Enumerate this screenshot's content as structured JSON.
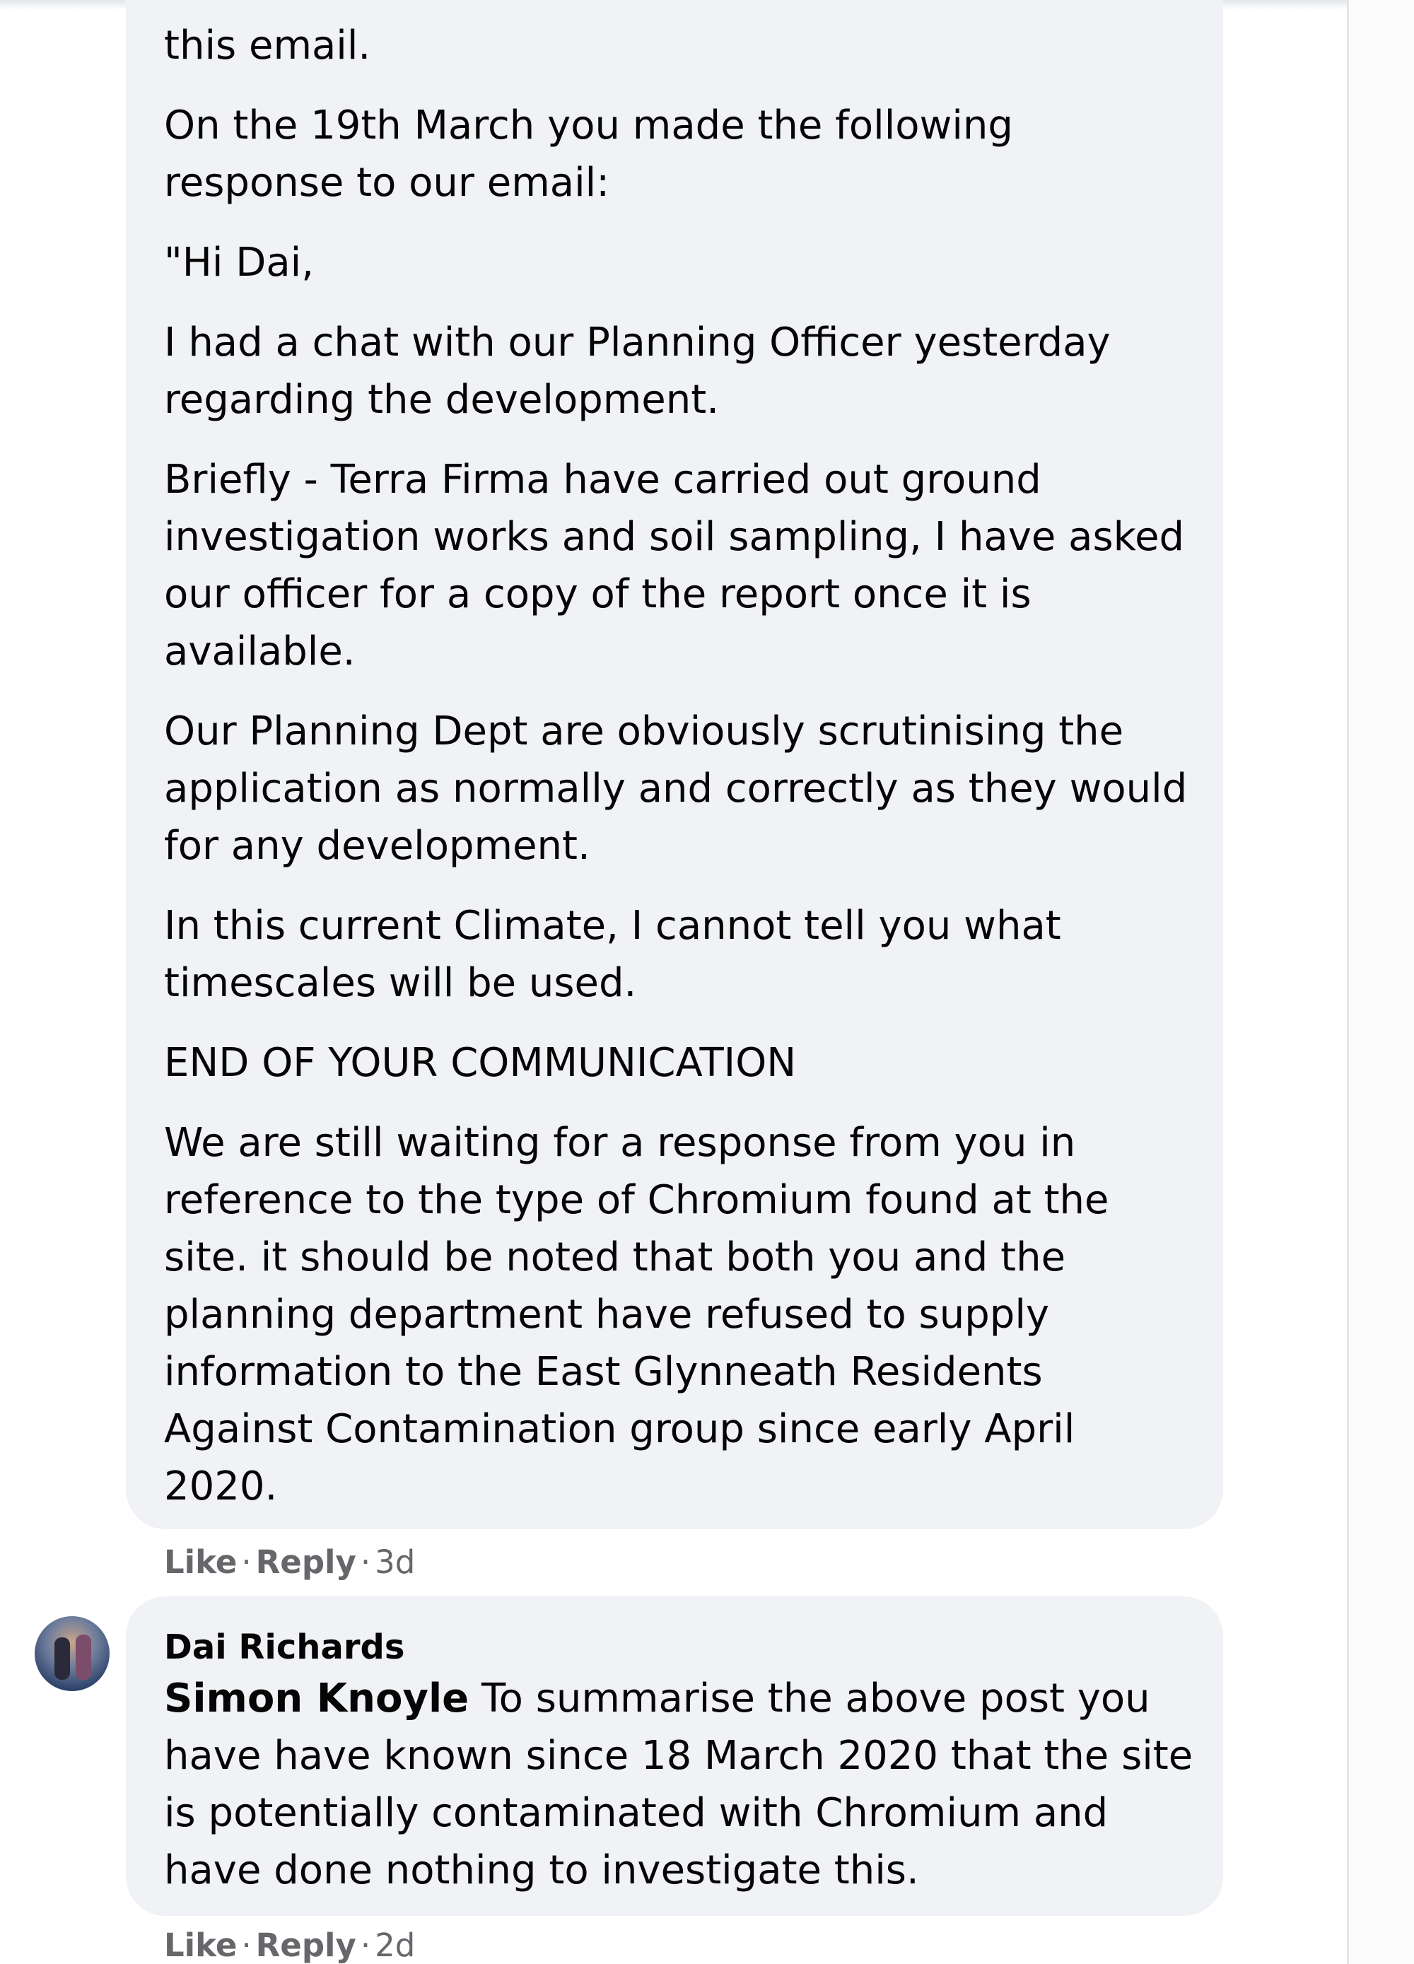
{
  "comment_1": {
    "paragraphs": [
      "this email.",
      "On the 19th March you made the following\nresponse to our email:",
      "\"Hi Dai,",
      "I had a chat with our Planning Officer yesterday\nregarding the development.",
      "Briefly - Terra Firma have carried out ground\ninvestigation works and soil sampling, I have asked\nour officer for a copy of the report once it is\navailable.",
      "Our Planning Dept are obviously scrutinising the\napplication as normally and correctly as they would\nfor any development.",
      "In this current Climate, I cannot tell you what\ntimescales will be used.",
      "END OF YOUR COMMUNICATION",
      "We are still waiting for a response from you in\nreference to the type of Chromium found at the\nsite. it should be noted that both you and the\nplanning department have refused to supply\ninformation to the East Glynneath Residents\nAgainst Contamination group since early April\n2020."
    ],
    "actions": {
      "like": "Like",
      "reply": "Reply",
      "time": "3d"
    }
  },
  "comment_2": {
    "author": "Dai Richards",
    "mention": "Simon Knoyle",
    "text": " To summarise the above post you\nhave have known since 18 March 2020 that the site\nis potentially contaminated with Chromium and\nhave done nothing to investigate this.",
    "actions": {
      "like": "Like",
      "reply": "Reply",
      "time": "2d"
    }
  },
  "separator": "·",
  "colors": {
    "bubble": "#f0f2f5",
    "text": "#050505",
    "meta": "#65676b"
  }
}
